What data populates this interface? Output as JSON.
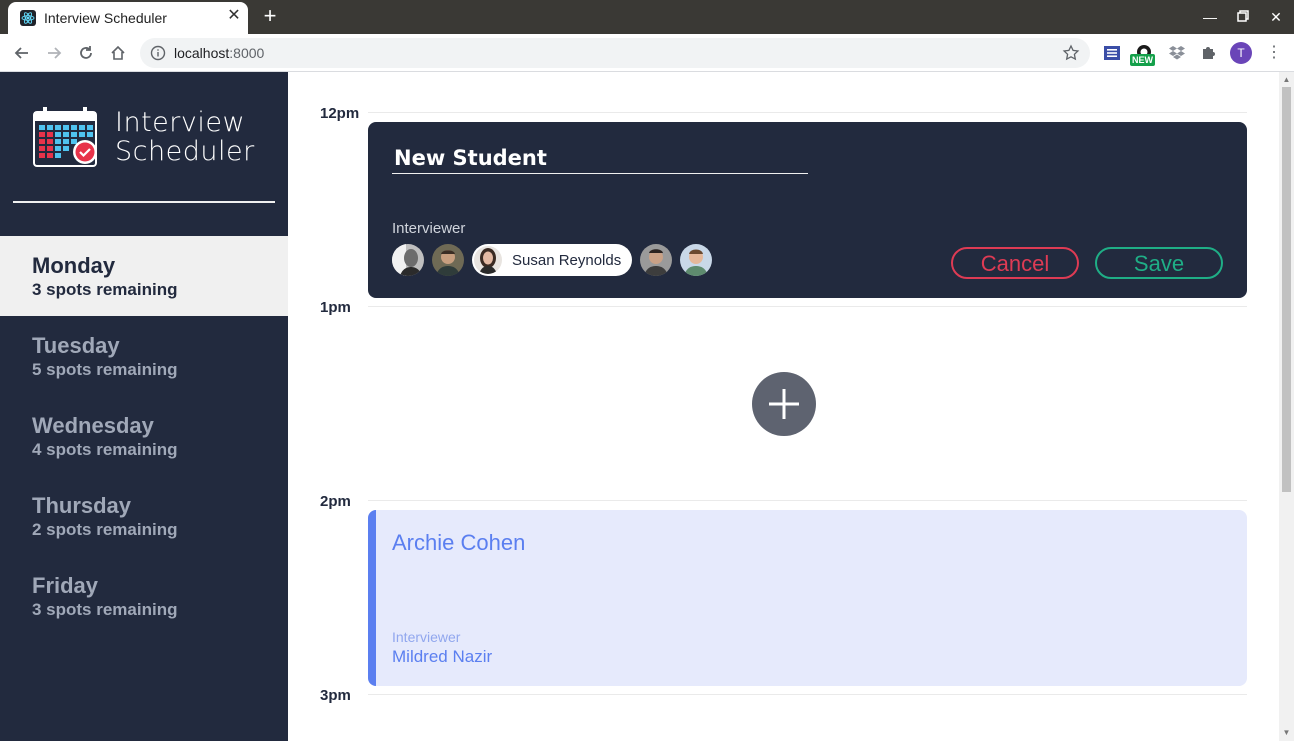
{
  "browser": {
    "tab_title": "Interview Scheduler",
    "url_host": "localhost",
    "url_port": ":8000",
    "new_badge": "NEW",
    "profile_initial": "T"
  },
  "app": {
    "brand_line1": "Interview",
    "brand_line2": "Scheduler",
    "days": [
      {
        "name": "Monday",
        "spots": "3 spots remaining",
        "selected": true
      },
      {
        "name": "Tuesday",
        "spots": "5 spots remaining",
        "selected": false
      },
      {
        "name": "Wednesday",
        "spots": "4 spots remaining",
        "selected": false
      },
      {
        "name": "Thursday",
        "spots": "2 spots remaining",
        "selected": false
      },
      {
        "name": "Friday",
        "spots": "3 spots remaining",
        "selected": false
      }
    ]
  },
  "schedule": {
    "times": [
      "12pm",
      "1pm",
      "2pm",
      "3pm"
    ],
    "form": {
      "student_value": "New Student",
      "interviewer_label": "Interviewer",
      "selected_interviewer": "Susan Reynolds",
      "cancel_label": "Cancel",
      "save_label": "Save"
    },
    "appointment": {
      "student": "Archie Cohen",
      "interviewer_label": "Interviewer",
      "interviewer": "Mildred Nazir"
    }
  },
  "colors": {
    "sidebar_bg": "#222a3e",
    "cancel": "#de3b54",
    "save": "#1fae86",
    "appointment_accent": "#5b7ff0"
  }
}
